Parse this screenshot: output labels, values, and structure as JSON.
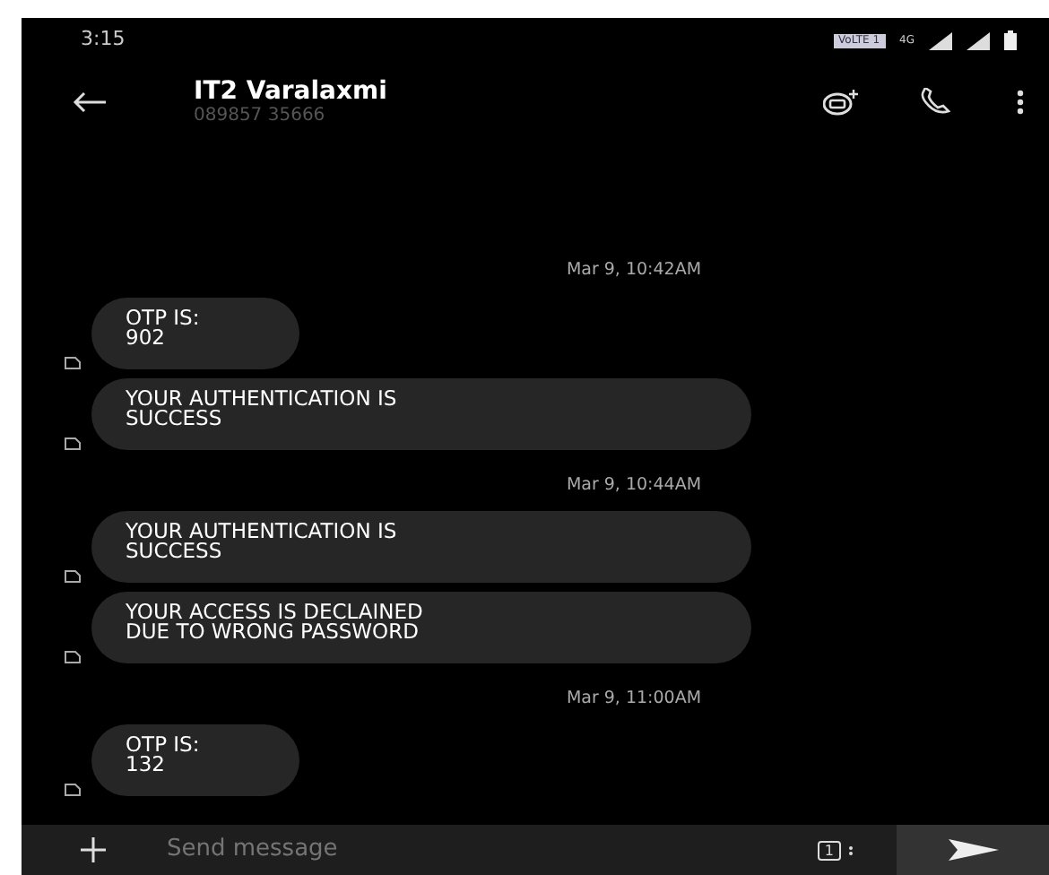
{
  "status_bar": {
    "time": "3:15",
    "network_badge": "VoLTE 1",
    "data_label": "4G"
  },
  "header": {
    "name": "IT2 Varalaxmi",
    "number": "089857 35666"
  },
  "messages": [
    {
      "kind": "timestamp",
      "text": "Mar 9, 10:42AM"
    },
    {
      "kind": "received",
      "text": "OTP IS:\n902"
    },
    {
      "kind": "received",
      "text": "YOUR AUTHENTICATION IS\nSUCCESS"
    },
    {
      "kind": "timestamp",
      "text": "Mar 9, 10:44AM"
    },
    {
      "kind": "received",
      "text": "YOUR AUTHENTICATION IS\nSUCCESS"
    },
    {
      "kind": "received",
      "text": "YOUR ACCESS IS DECLAINED\nDUE TO WRONG PASSWORD"
    },
    {
      "kind": "timestamp",
      "text": "Mar 9, 11:00AM"
    },
    {
      "kind": "received",
      "text": "OTP IS:\n132"
    }
  ],
  "composer": {
    "placeholder": "Send message",
    "sim_label": "1"
  }
}
